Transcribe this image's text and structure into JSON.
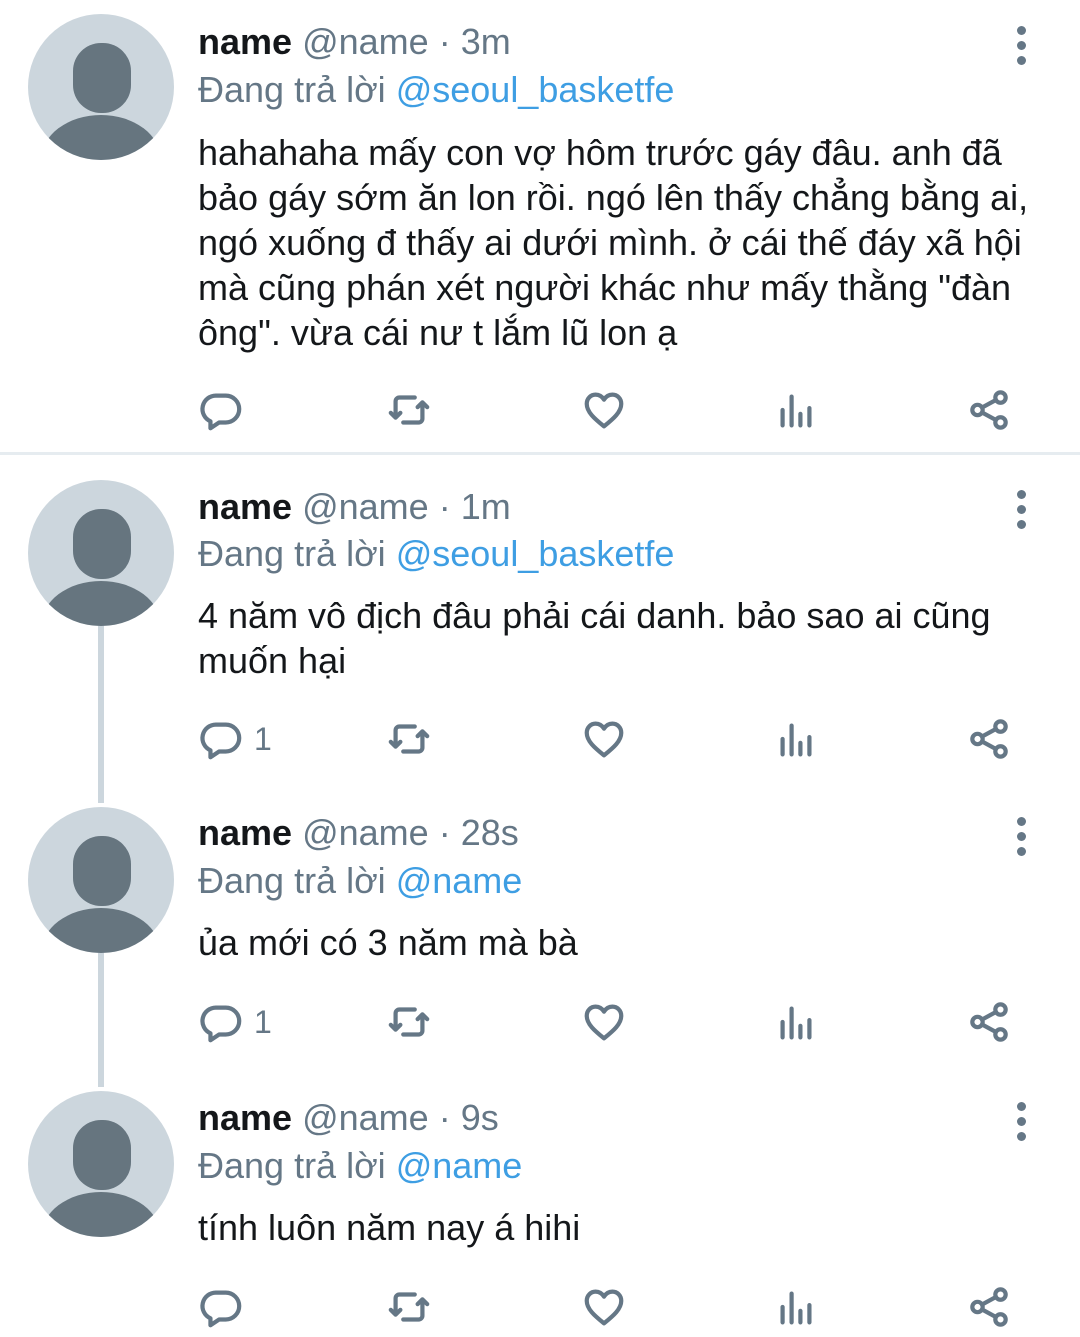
{
  "tweets": [
    {
      "name": "name",
      "handle": "@name",
      "separator": "·",
      "time": "3m",
      "replying_prefix": "Đang trả lời",
      "replying_to": "@seoul_basketfe",
      "text": "hahahaha mấy con vợ hôm trước gáy đâu. anh đã bảo gáy sớm ăn lon rồi. ngó lên thấy chẳng bằng ai, ngó xuống đ thấy ai dưới mình. ở cái thế đáy xã hội mà cũng phán xét người khác như mấy thằng \"đàn ông\". vừa cái nư t lắm lũ lon ạ",
      "reply_count": ""
    },
    {
      "name": "name",
      "handle": "@name",
      "separator": "·",
      "time": "1m",
      "replying_prefix": "Đang trả lời",
      "replying_to": "@seoul_basketfe",
      "text": "4 năm vô địch đâu phải cái danh. bảo sao ai cũng muốn hại",
      "reply_count": "1"
    },
    {
      "name": "name",
      "handle": "@name",
      "separator": "·",
      "time": "28s",
      "replying_prefix": "Đang trả lời",
      "replying_to": "@name",
      "text": "ủa mới có 3 năm mà bà",
      "reply_count": "1"
    },
    {
      "name": "name",
      "handle": "@name",
      "separator": "·",
      "time": "9s",
      "replying_prefix": "Đang trả lời",
      "replying_to": "@name",
      "text": "tính luôn năm nay á hihi",
      "reply_count": ""
    }
  ],
  "icons": {
    "reply": "reply-icon",
    "retweet": "retweet-icon",
    "like": "heart-icon",
    "analytics": "analytics-icon",
    "share": "share-icon",
    "more": "more-vertical-icon"
  },
  "colors": {
    "link": "#3e9ee3",
    "muted": "#657786",
    "avatar_bg": "#ccd6dd",
    "avatar_fg": "#66757f"
  }
}
